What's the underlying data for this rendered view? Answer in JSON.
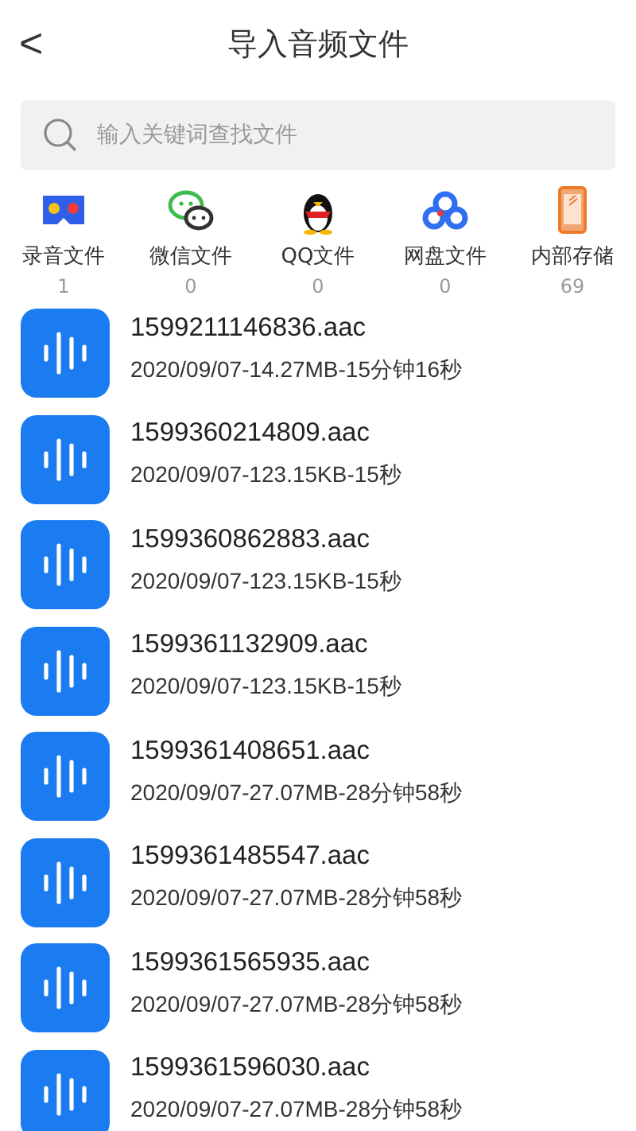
{
  "header": {
    "back": "<",
    "title": "导入音频文件"
  },
  "search": {
    "placeholder": "输入关键词查找文件"
  },
  "categories": [
    {
      "kind": "recorder",
      "label": "录音文件",
      "count": "1"
    },
    {
      "kind": "wechat",
      "label": "微信文件",
      "count": "0"
    },
    {
      "kind": "qq",
      "label": "QQ文件",
      "count": "0"
    },
    {
      "kind": "cloud",
      "label": "网盘文件",
      "count": "0"
    },
    {
      "kind": "phone",
      "label": "内部存储",
      "count": "69"
    }
  ],
  "files": [
    {
      "name": "1599211146836.aac",
      "meta": "2020/09/07-14.27MB-15分钟16秒"
    },
    {
      "name": "1599360214809.aac",
      "meta": "2020/09/07-123.15KB-15秒"
    },
    {
      "name": "1599360862883.aac",
      "meta": "2020/09/07-123.15KB-15秒"
    },
    {
      "name": "1599361132909.aac",
      "meta": "2020/09/07-123.15KB-15秒"
    },
    {
      "name": "1599361408651.aac",
      "meta": "2020/09/07-27.07MB-28分钟58秒"
    },
    {
      "name": "1599361485547.aac",
      "meta": "2020/09/07-27.07MB-28分钟58秒"
    },
    {
      "name": "1599361565935.aac",
      "meta": "2020/09/07-27.07MB-28分钟58秒"
    },
    {
      "name": "1599361596030.aac",
      "meta": "2020/09/07-27.07MB-28分钟58秒"
    }
  ]
}
